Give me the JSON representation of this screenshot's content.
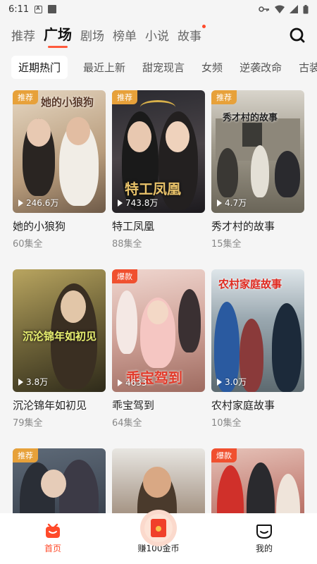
{
  "status": {
    "time": "6:11"
  },
  "top_tabs": [
    {
      "label": "推荐"
    },
    {
      "label": "广场",
      "active": true
    },
    {
      "label": "剧场"
    },
    {
      "label": "榜单"
    },
    {
      "label": "小说"
    },
    {
      "label": "故事",
      "has_dot": true
    }
  ],
  "sub_categories": [
    {
      "label": "近期热门",
      "active": true
    },
    {
      "label": "最近上新"
    },
    {
      "label": "甜宠现言"
    },
    {
      "label": "女频"
    },
    {
      "label": "逆袭改命"
    },
    {
      "label": "古装"
    }
  ],
  "dramas": [
    {
      "badge": "推荐",
      "badge_type": "tj",
      "views": "246.6万",
      "title": "她的小狼狗",
      "episodes": "60集全",
      "poster_text": "她的小狼狗",
      "bg": "#c9b49a"
    },
    {
      "badge": "推荐",
      "badge_type": "tj",
      "views": "743.8万",
      "title": "特工凤凰",
      "episodes": "88集全",
      "poster_text": "特工凤凰",
      "bg": "#3b3a3f"
    },
    {
      "badge": "推荐",
      "badge_type": "tj",
      "views": "4.7万",
      "title": "秀才村的故事",
      "episodes": "15集全",
      "poster_text": "秀才村的故事",
      "bg": "#8b8676"
    },
    {
      "badge": "",
      "badge_type": "",
      "views": "3.8万",
      "title": "沉沦锦年如初见",
      "episodes": "79集全",
      "poster_text": "沉沦锦年如初见",
      "bg": "#5f5a3c"
    },
    {
      "badge": "爆款",
      "badge_type": "bk",
      "views": "4633",
      "title": "乖宝驾到",
      "episodes": "64集全",
      "poster_text": "乖宝驾到",
      "bg": "#c7928a"
    },
    {
      "badge": "",
      "badge_type": "",
      "views": "3.0万",
      "title": "农村家庭故事",
      "episodes": "10集全",
      "poster_text": "农村家庭故事",
      "bg": "#7b8a94"
    },
    {
      "badge": "推荐",
      "badge_type": "tj",
      "views": "",
      "title": "",
      "episodes": "",
      "poster_text": "",
      "bg": "#4d5560"
    },
    {
      "badge": "",
      "badge_type": "",
      "views": "",
      "title": "",
      "episodes": "",
      "poster_text": "",
      "bg": "#8a7564"
    },
    {
      "badge": "爆款",
      "badge_type": "bk",
      "views": "",
      "title": "",
      "episodes": "",
      "poster_text": "",
      "bg": "#b46f66"
    }
  ],
  "bottom_nav": {
    "home": "首页",
    "coins": "赚100金币",
    "me": "我的"
  },
  "colors": {
    "accent": "#ff4a2a",
    "badge_recommend": "#e7a13a",
    "badge_hot": "#f0502f"
  }
}
